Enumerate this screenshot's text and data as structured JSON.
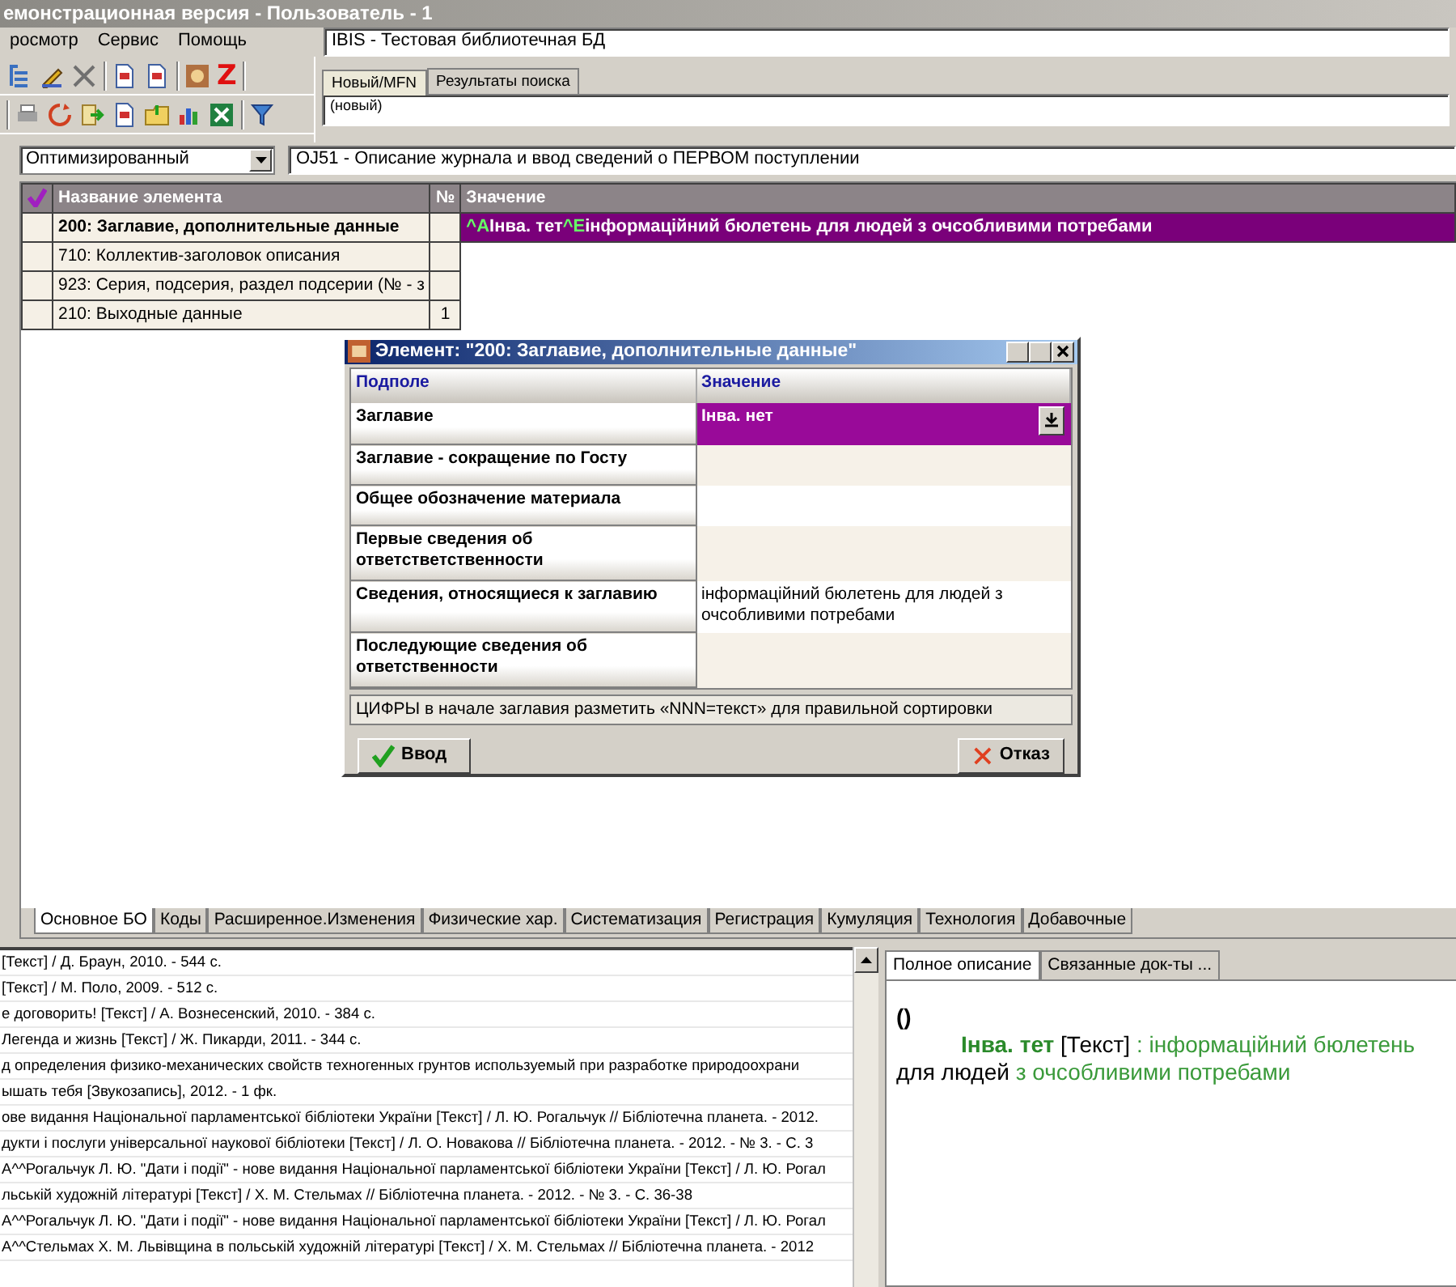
{
  "window": {
    "title": "емонстрационная версия - Пользователь - 1"
  },
  "menu": [
    {
      "label": "росмотр"
    },
    {
      "label": "Сервис"
    },
    {
      "label": "Помощь"
    }
  ],
  "database_field": {
    "value": "IBIS - Тестовая библиотечная БД"
  },
  "toolbar": {
    "z_label": "Z"
  },
  "record_tabs": [
    {
      "label": "Новый/MFN",
      "selected": true
    },
    {
      "label": "Результаты поиска",
      "selected": false
    }
  ],
  "record_field": {
    "value": "(новый)"
  },
  "mode_select": {
    "value": "Оптимизированный"
  },
  "worksheet_field": {
    "value": "OJ51 - Описание журнала и ввод сведений о ПЕРВОМ поступлении"
  },
  "grid": {
    "columns": [
      "Название элемента",
      "№",
      "Значение"
    ],
    "rows": [
      {
        "name": "200: Заглавие, дополнительные данные",
        "selected": true,
        "value": [
          {
            "text": "^A",
            "kind": "marker"
          },
          {
            "text": "Інва. тет",
            "kind": "text"
          },
          {
            "text": "^E",
            "kind": "marker"
          },
          {
            "text": "інформаційний бюлетень для людей з очсобливими потребами",
            "kind": "text"
          }
        ]
      },
      {
        "name": "710: Коллектив-заголовок описания",
        "selected": false
      },
      {
        "name": "923: Серия, подсерия, раздел подсерии (№ - з",
        "selected": false
      },
      {
        "name": "210: Выходные данные",
        "selected": false,
        "number": "1"
      }
    ]
  },
  "dialog": {
    "title": "Элемент: \"200: Заглавие, дополнительные данные\"",
    "columns": [
      "Подполе",
      "Значение"
    ],
    "rows": [
      {
        "name": "Заглавие",
        "selected": true,
        "value": "Інва. нет"
      },
      {
        "name": "Заглавие - сокращение по Госту",
        "selected": false
      },
      {
        "name": "Общее обозначение материала",
        "selected": false
      },
      {
        "name": "Первые сведения об ответстветственности",
        "selected": false
      },
      {
        "name": "Сведения, относящиеся к заглавию",
        "selected": false,
        "value": "інформаційний бюлетень для людей з очсобливими потребами"
      },
      {
        "name": "Последующие сведения об ответственности",
        "selected": false
      }
    ],
    "hint": "ЦИФРЫ в начале заглавия разметить «NNN=текст» для правильной сортировки",
    "buttons": [
      {
        "label": "Ввод",
        "kind": "ok"
      },
      {
        "label": "Отказ",
        "kind": "cancel"
      }
    ]
  },
  "section_tabs": [
    {
      "label": "Основное БО",
      "selected": true
    },
    {
      "label": "Коды",
      "selected": false
    },
    {
      "label": "Расширенное.Изменения",
      "selected": false
    },
    {
      "label": "Физические хар.",
      "selected": false
    },
    {
      "label": "Систематизация",
      "selected": false
    },
    {
      "label": "Регистрация",
      "selected": false
    },
    {
      "label": "Кумуляция",
      "selected": false
    },
    {
      "label": "Технология",
      "selected": false
    },
    {
      "label": "Добавочные",
      "selected": false
    }
  ],
  "results": [
    "[Текст] / Д. Браун, 2010. - 544 с.",
    "[Текст] / М. Поло, 2009. - 512 с.",
    "е договорить! [Текст] / А. Вознесенский, 2010. - 384 с.",
    "Легенда и жизнь [Текст] / Ж. Пикарди, 2011. - 344 с.",
    "д определения физико-механических свойств техногенных грунтов используемый при разработке природоохрани",
    "ышать тебя [Звукозапись], 2012. - 1 фк.",
    "ове видання Національної парламентської бібліотеки України [Текст] / Л. Ю. Рогальчук // Бібліотечна планета. - 2012.",
    "дукти і послуги універсальної наукової бібліотеки [Текст] / Л. О. Новакова // Бібліотечна планета. - 2012. - № 3. - С. 3",
    "А^^Рогальчук Л. Ю. \"Дати і події\" - нове видання Національної парламентської бібліотеки України [Текст] / Л. Ю. Рогал",
    "льській художній літературі [Текст] / Х. М. Стельмах // Бібліотечна планета. - 2012. - № 3. -  С. 36-38",
    "А^^Рогальчук Л. Ю. \"Дати і події\" - нове видання Національної парламентської бібліотеки України [Текст] / Л. Ю. Рогал",
    "А^^Стельмах Х. М. Львівщина в польській художній літературі [Текст] / Х. М. Стельмах // Бібліотечна планета. - 2012"
  ],
  "preview_tabs": [
    {
      "label": "Полное описание",
      "selected": true
    },
    {
      "label": "Связанные док-ты ...",
      "selected": false
    }
  ],
  "preview": {
    "heading": "()",
    "segments": [
      {
        "text": "Інва. тет",
        "kind": "title"
      },
      {
        "text": " [Текст]",
        "kind": "plain"
      },
      {
        "text": " : інформаційний бюлетень",
        "kind": "info"
      },
      {
        "text": " для людей",
        "kind": "plain"
      },
      {
        "text": " з очсобливими потребами",
        "kind": "info"
      }
    ]
  }
}
